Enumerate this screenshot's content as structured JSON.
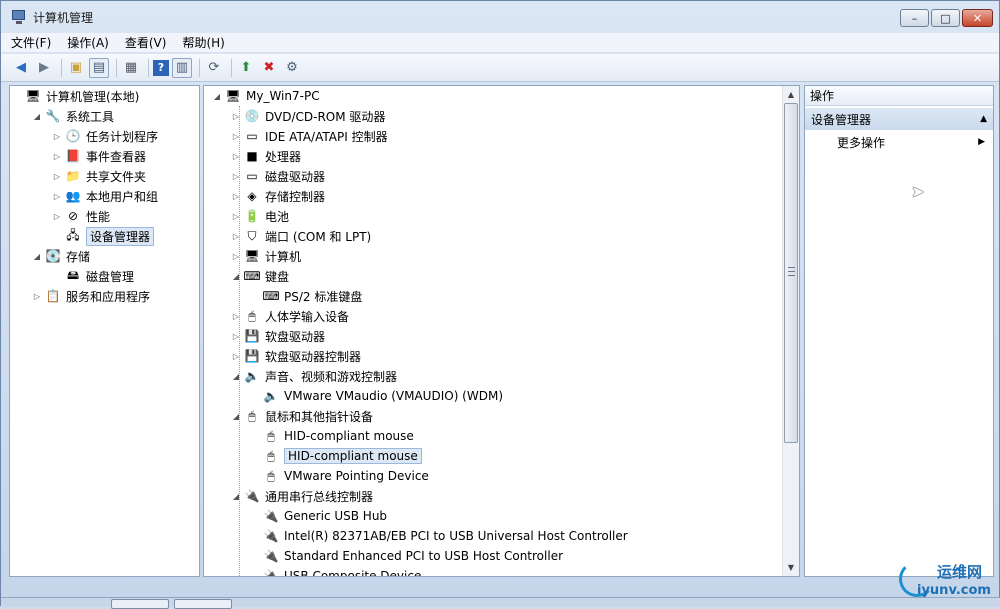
{
  "window": {
    "title": "计算机管理",
    "min": "–",
    "max": "□",
    "close": "✕"
  },
  "menu": [
    "文件(F)",
    "操作(A)",
    "查看(V)",
    "帮助(H)"
  ],
  "left_tree": [
    {
      "label": "计算机管理(本地)",
      "level": 0,
      "exp": "",
      "icon": "🖥"
    },
    {
      "label": "系统工具",
      "level": 1,
      "exp": "◢",
      "icon": "🔧"
    },
    {
      "label": "任务计划程序",
      "level": 2,
      "exp": "▷",
      "icon": "🕒"
    },
    {
      "label": "事件查看器",
      "level": 2,
      "exp": "▷",
      "icon": "📕"
    },
    {
      "label": "共享文件夹",
      "level": 2,
      "exp": "▷",
      "icon": "📁"
    },
    {
      "label": "本地用户和组",
      "level": 2,
      "exp": "▷",
      "icon": "👥"
    },
    {
      "label": "性能",
      "level": 2,
      "exp": "▷",
      "icon": "⊘"
    },
    {
      "label": "设备管理器",
      "level": 2,
      "exp": "",
      "icon": "🖧",
      "selected": true
    },
    {
      "label": "存储",
      "level": 1,
      "exp": "◢",
      "icon": "💽"
    },
    {
      "label": "磁盘管理",
      "level": 2,
      "exp": "",
      "icon": "🖴"
    },
    {
      "label": "服务和应用程序",
      "level": 1,
      "exp": "▷",
      "icon": "📋"
    }
  ],
  "device_tree": [
    {
      "label": "My_Win7-PC",
      "level": 0,
      "exp": "◢",
      "icon": "🖥"
    },
    {
      "label": "DVD/CD-ROM 驱动器",
      "level": 1,
      "exp": "▷",
      "icon": "💿"
    },
    {
      "label": "IDE ATA/ATAPI 控制器",
      "level": 1,
      "exp": "▷",
      "icon": "▭"
    },
    {
      "label": "处理器",
      "level": 1,
      "exp": "▷",
      "icon": "■"
    },
    {
      "label": "磁盘驱动器",
      "level": 1,
      "exp": "▷",
      "icon": "▭"
    },
    {
      "label": "存储控制器",
      "level": 1,
      "exp": "▷",
      "icon": "◈"
    },
    {
      "label": "电池",
      "level": 1,
      "exp": "▷",
      "icon": "🔋"
    },
    {
      "label": "端口 (COM 和 LPT)",
      "level": 1,
      "exp": "▷",
      "icon": "⛉"
    },
    {
      "label": "计算机",
      "level": 1,
      "exp": "▷",
      "icon": "🖥"
    },
    {
      "label": "键盘",
      "level": 1,
      "exp": "◢",
      "icon": "⌨"
    },
    {
      "label": "PS/2 标准键盘",
      "level": 2,
      "exp": "",
      "icon": "⌨"
    },
    {
      "label": "人体学输入设备",
      "level": 1,
      "exp": "▷",
      "icon": "🖱"
    },
    {
      "label": "软盘驱动器",
      "level": 1,
      "exp": "▷",
      "icon": "💾"
    },
    {
      "label": "软盘驱动器控制器",
      "level": 1,
      "exp": "▷",
      "icon": "💾"
    },
    {
      "label": "声音、视频和游戏控制器",
      "level": 1,
      "exp": "◢",
      "icon": "🔈"
    },
    {
      "label": "VMware VMaudio (VMAUDIO) (WDM)",
      "level": 2,
      "exp": "",
      "icon": "🔈"
    },
    {
      "label": "鼠标和其他指针设备",
      "level": 1,
      "exp": "◢",
      "icon": "🖱"
    },
    {
      "label": "HID-compliant mouse",
      "level": 2,
      "exp": "",
      "icon": "🖱"
    },
    {
      "label": "HID-compliant mouse",
      "level": 2,
      "exp": "",
      "icon": "🖱",
      "selected": true
    },
    {
      "label": "VMware Pointing Device",
      "level": 2,
      "exp": "",
      "icon": "🖱"
    },
    {
      "label": "通用串行总线控制器",
      "level": 1,
      "exp": "◢",
      "icon": "🔌"
    },
    {
      "label": "Generic USB Hub",
      "level": 2,
      "exp": "",
      "icon": "🔌"
    },
    {
      "label": "Intel(R) 82371AB/EB PCI to USB Universal Host Controller",
      "level": 2,
      "exp": "",
      "icon": "🔌"
    },
    {
      "label": "Standard Enhanced PCI to USB Host Controller",
      "level": 2,
      "exp": "",
      "icon": "🔌"
    },
    {
      "label": "USB Composite Device",
      "level": 2,
      "exp": "",
      "icon": "🔌"
    }
  ],
  "actions": {
    "header": "操作",
    "section": "设备管理器",
    "section_arrow": "▲",
    "more": "更多操作",
    "more_arrow": "▶"
  },
  "watermark": {
    "cn": "运维网",
    "en": "iyunv.com"
  }
}
